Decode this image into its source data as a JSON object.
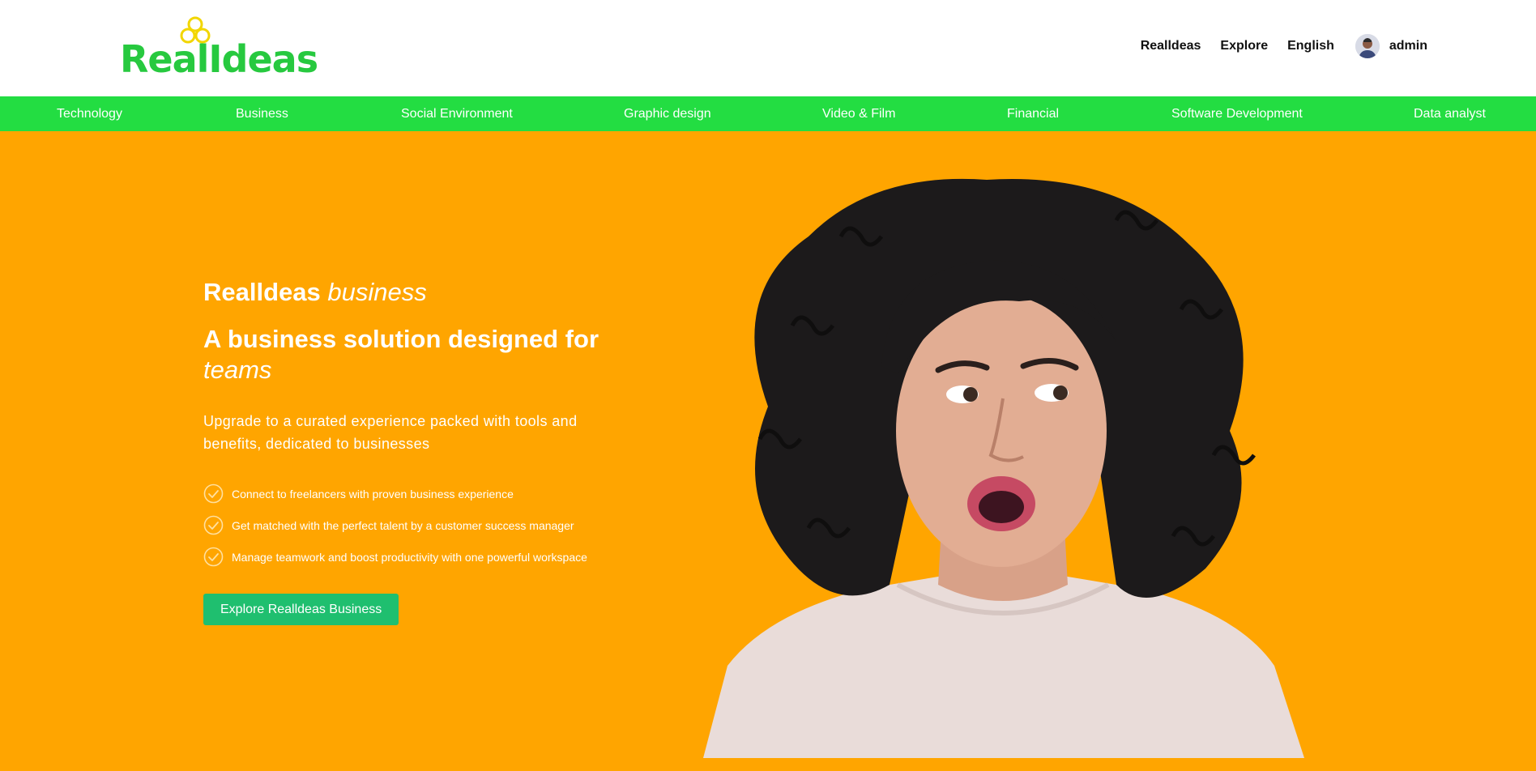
{
  "header": {
    "logo_text": "RealIdeas",
    "nav": [
      {
        "label": "Realldeas"
      },
      {
        "label": "Explore"
      },
      {
        "label": "English"
      }
    ],
    "user_name": "admin"
  },
  "categories": [
    {
      "label": "Technology"
    },
    {
      "label": "Business"
    },
    {
      "label": "Social Environment"
    },
    {
      "label": "Graphic design"
    },
    {
      "label": "Video & Film"
    },
    {
      "label": "Financial"
    },
    {
      "label": "Software Development"
    },
    {
      "label": "Data analyst"
    }
  ],
  "hero": {
    "brand": "Realldeas",
    "brand_suffix": "business",
    "headline": "A business solution designed for",
    "headline_italic": "teams",
    "subtitle": "Upgrade to a curated experience packed with tools and benefits, dedicated to businesses",
    "checklist": [
      {
        "text": "Connect to freelancers with proven business experience"
      },
      {
        "text": "Get matched with the perfect talent by a customer success manager"
      },
      {
        "text": "Manage teamwork and boost productivity with one powerful workspace"
      }
    ],
    "cta_label": "Explore Realldeas Business"
  },
  "colors": {
    "brand_green": "#27c93f",
    "category_bar": "#23dd42",
    "hero_bg": "#ffa500",
    "cta_bg": "#1fbf6f",
    "logo_mark": "#f2d600"
  },
  "icons": {
    "logo_mark": "three-circle-logo-icon",
    "check": "check-circle-icon"
  }
}
